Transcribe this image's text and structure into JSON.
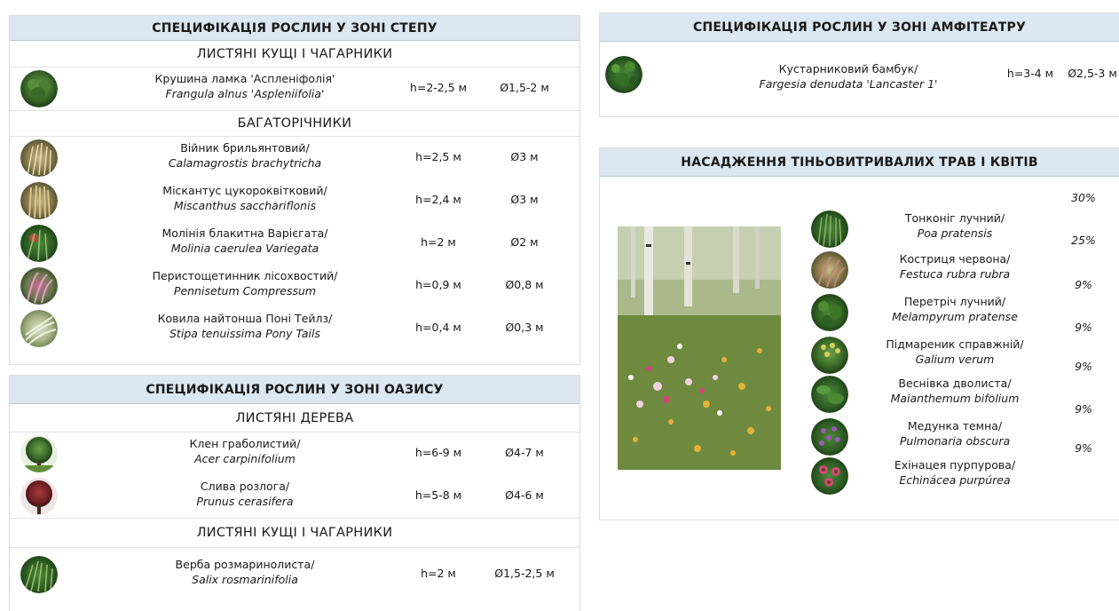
{
  "steppe": {
    "title": "СПЕЦИФІКАЦІЯ РОСЛИН У ЗОНІ СТЕПУ",
    "sections": [
      {
        "heading": "ЛИСТЯНІ КУЩІ І ЧАГАРНИКИ",
        "plants": [
          {
            "name": "Крушина ламка 'Аспленіфолія'",
            "latin": "Frangula alnus 'Aspleniifolia'",
            "height": "h=2-2,5 м",
            "diameter": "Ø1,5-2 м"
          }
        ]
      },
      {
        "heading": "БАГАТОРІЧНИКИ",
        "plants": [
          {
            "name": "Війник брильянтовий/",
            "latin": "Calamagrostis brachytricha",
            "height": "h=2,5 м",
            "diameter": "Ø3 м"
          },
          {
            "name": "Міскантус цукороквітковий/",
            "latin": "Miscanthus sacchariflonis",
            "height": "h=2,4 м",
            "diameter": "Ø3 м"
          },
          {
            "name": "Молінія блакитна Варієгата/",
            "latin": "Molinia caerulea Variegata",
            "height": "h=2 м",
            "diameter": "Ø2 м"
          },
          {
            "name": "Перистощетинник лісохвостий/",
            "latin": "Pennisetum Compressum",
            "height": "h=0,9 м",
            "diameter": "Ø0,8 м"
          },
          {
            "name": "Ковила найтонша Поні Тейлз/",
            "latin": "Stipa tenuissima Pony Tails",
            "height": "h=0,4 м",
            "diameter": "Ø0,3 м"
          }
        ]
      }
    ]
  },
  "oasis": {
    "title": "СПЕЦИФІКАЦІЯ РОСЛИН У ЗОНІ ОАЗИСУ",
    "sections": [
      {
        "heading": "ЛИСТЯНІ ДЕРЕВА",
        "plants": [
          {
            "name": "Клен граболистий/",
            "latin": "Acer carpinifolium",
            "height": "h=6-9 м",
            "diameter": "Ø4-7 м"
          },
          {
            "name": "Слива розлога/",
            "latin": "Prunus cerasifera",
            "height": "h=5-8 м",
            "diameter": "Ø4-6 м"
          }
        ]
      },
      {
        "heading": "ЛИСТЯНІ КУЩІ І ЧАГАРНИКИ",
        "plants": [
          {
            "name": "Верба розмаринолиста/",
            "latin": "Salix rosmarinifolia",
            "height": "h=2 м",
            "diameter": "Ø1,5-2,5 м"
          }
        ]
      }
    ]
  },
  "amphitheatre": {
    "title": "СПЕЦИФІКАЦІЯ РОСЛИН У ЗОНІ АМФІТЕАТРУ",
    "plant": {
      "name": "Кустарниковий бамбук/",
      "latin": "Fargesia denudata 'Lancaster 1'",
      "height": "h=3-4 м",
      "diameter": "Ø2,5-3 м"
    }
  },
  "shade": {
    "title": "НАСАДЖЕННЯ ТІНЬОВИТРИВАЛИХ ТРАВ І КВІТІВ",
    "percents": [
      "30%",
      "25%",
      "9%",
      "9%",
      "9%",
      "9%",
      "9%"
    ],
    "plants": [
      {
        "name": "Тонконіг лучний/",
        "latin": "Poa pratensis"
      },
      {
        "name": "Костриця червона/",
        "latin": "Festuca rubra rubra"
      },
      {
        "name": "Перетріч лучний/",
        "latin": "Melampyrum pratense"
      },
      {
        "name": "Підмареник справжній/",
        "latin": "Galium verum"
      },
      {
        "name": "Веснівка дволиста/",
        "latin": "Maianthemum bifolium"
      },
      {
        "name": "Медунка темна/",
        "latin": "Pulmonaria obscura"
      },
      {
        "name": "Ехінацея пурпурова/",
        "latin": "Echinácea purpúrea"
      }
    ]
  }
}
